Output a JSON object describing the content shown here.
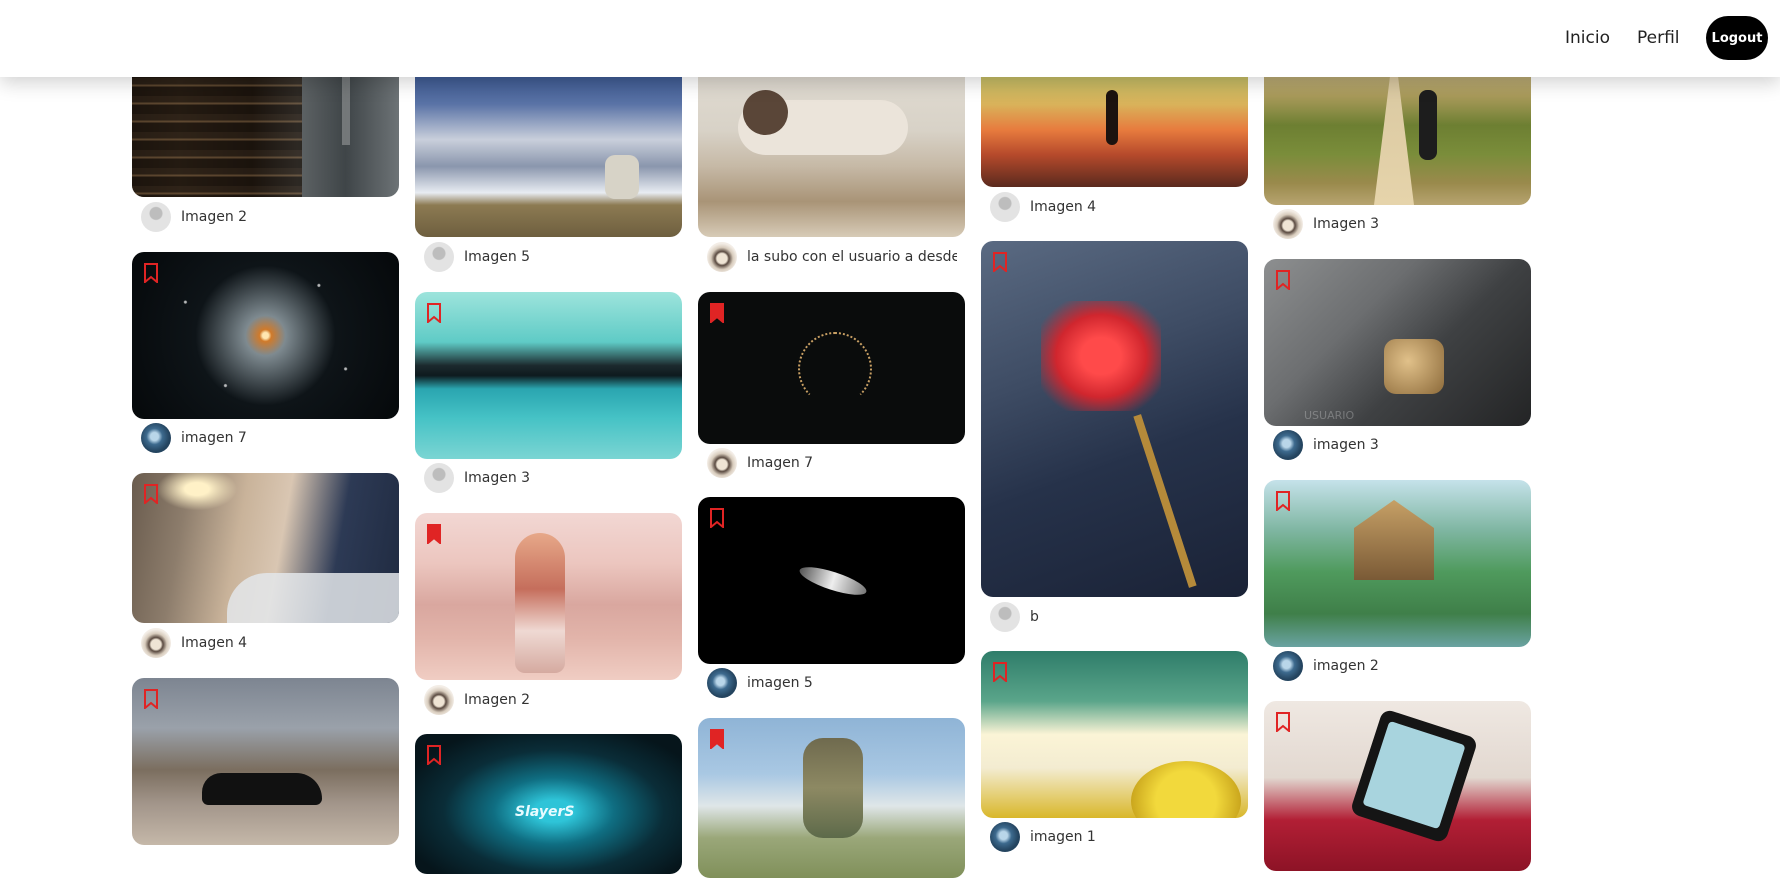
{
  "nav": {
    "inicio": "Inicio",
    "perfil": "Perfil",
    "logout": "Logout"
  },
  "captions": {
    "c1_1": "Imagen 2",
    "c1_2": "imagen 7",
    "c1_3": "Imagen 4",
    "c2_1": "Imagen 5",
    "c2_2": "Imagen 3",
    "c2_3": "Imagen 2",
    "c3_1": "la subo con el usuario a desde c",
    "c3_2": "Imagen 7",
    "c3_3": "imagen 5",
    "c4_1": "Imagen 4",
    "c4_2": "b",
    "c4_3": "imagen 1",
    "c5_1": "Imagen 3",
    "c5_2": "imagen 3",
    "c5_3": "imagen 2"
  },
  "image_text": {
    "slayers": "SlayerS",
    "watermark": "USUARIO"
  },
  "colors": {
    "bookmark": "#e02424",
    "logout_bg": "#000000"
  },
  "icons": [
    "bookmark-icon",
    "avatar-icon"
  ]
}
